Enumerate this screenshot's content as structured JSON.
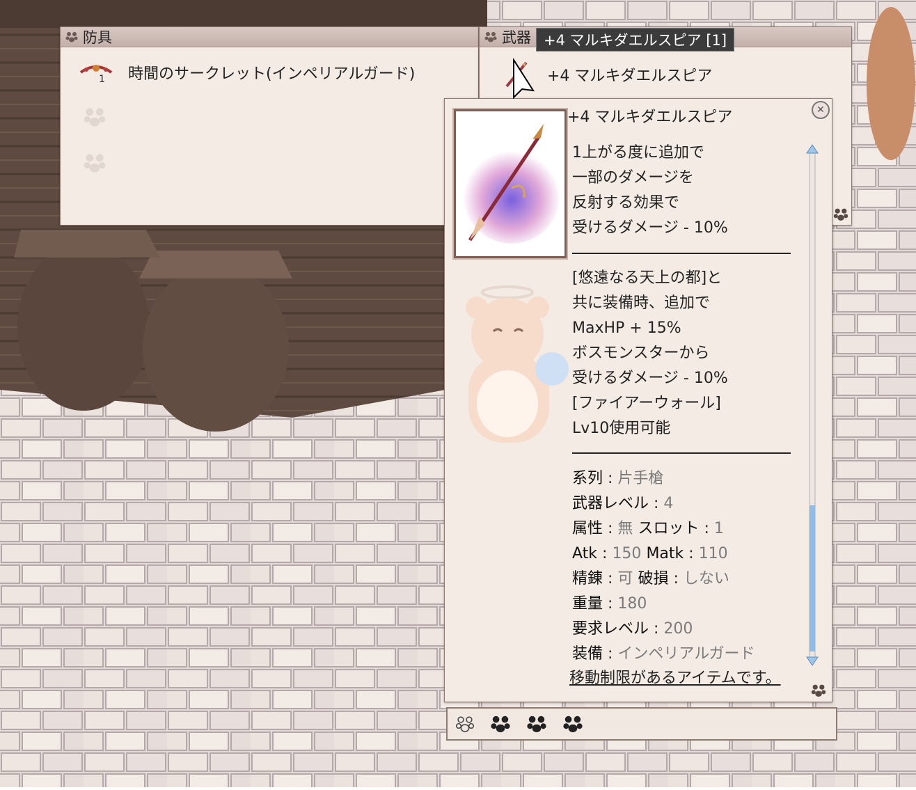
{
  "armor_window": {
    "title": "防具",
    "slot_item": "時間のサークレット(インペリアルガード)",
    "slot_badge": "1"
  },
  "weapon_window": {
    "title": "武器",
    "slot_item": "+4 マルキダエルスピア"
  },
  "hover_tooltip": "+4 マルキダエルスピア [1]",
  "item_description": {
    "name": "+4 マルキダエルスピア",
    "effect_lines": [
      "1上がる度に追加で",
      "一部のダメージを",
      "反射する効果で",
      "受けるダメージ - 10%"
    ],
    "set_lines": [
      "[悠遠なる天上の都]と",
      "共に装備時、追加で",
      "MaxHP + 15%",
      "ボスモンスターから",
      "受けるダメージ - 10%",
      "[ファイアーウォール]",
      "Lv10使用可能"
    ],
    "stats": {
      "type_label": "系列",
      "type_value": "片手槍",
      "weapon_level_label": "武器レベル",
      "weapon_level_value": "4",
      "element_label": "属性",
      "element_value": "無",
      "slot_label": "スロット",
      "slot_value": "1",
      "atk_label": "Atk",
      "atk_value": "150",
      "matk_label": "Matk",
      "matk_value": "110",
      "refine_label": "精錬",
      "refine_value": "可",
      "break_label": "破損",
      "break_value": "しない",
      "weight_label": "重量",
      "weight_value": "180",
      "req_level_label": "要求レベル",
      "req_level_value": "200",
      "equip_label": "装備",
      "equip_value": "インペリアルガード"
    },
    "restriction_note": "移動制限があるアイテムです。"
  },
  "colors": {
    "window_bg": "#f4ebe5",
    "title_bar": "#c9b6b0",
    "tooltip_bg": "#3b3b3b",
    "scrollbar": "#8fbde6"
  }
}
